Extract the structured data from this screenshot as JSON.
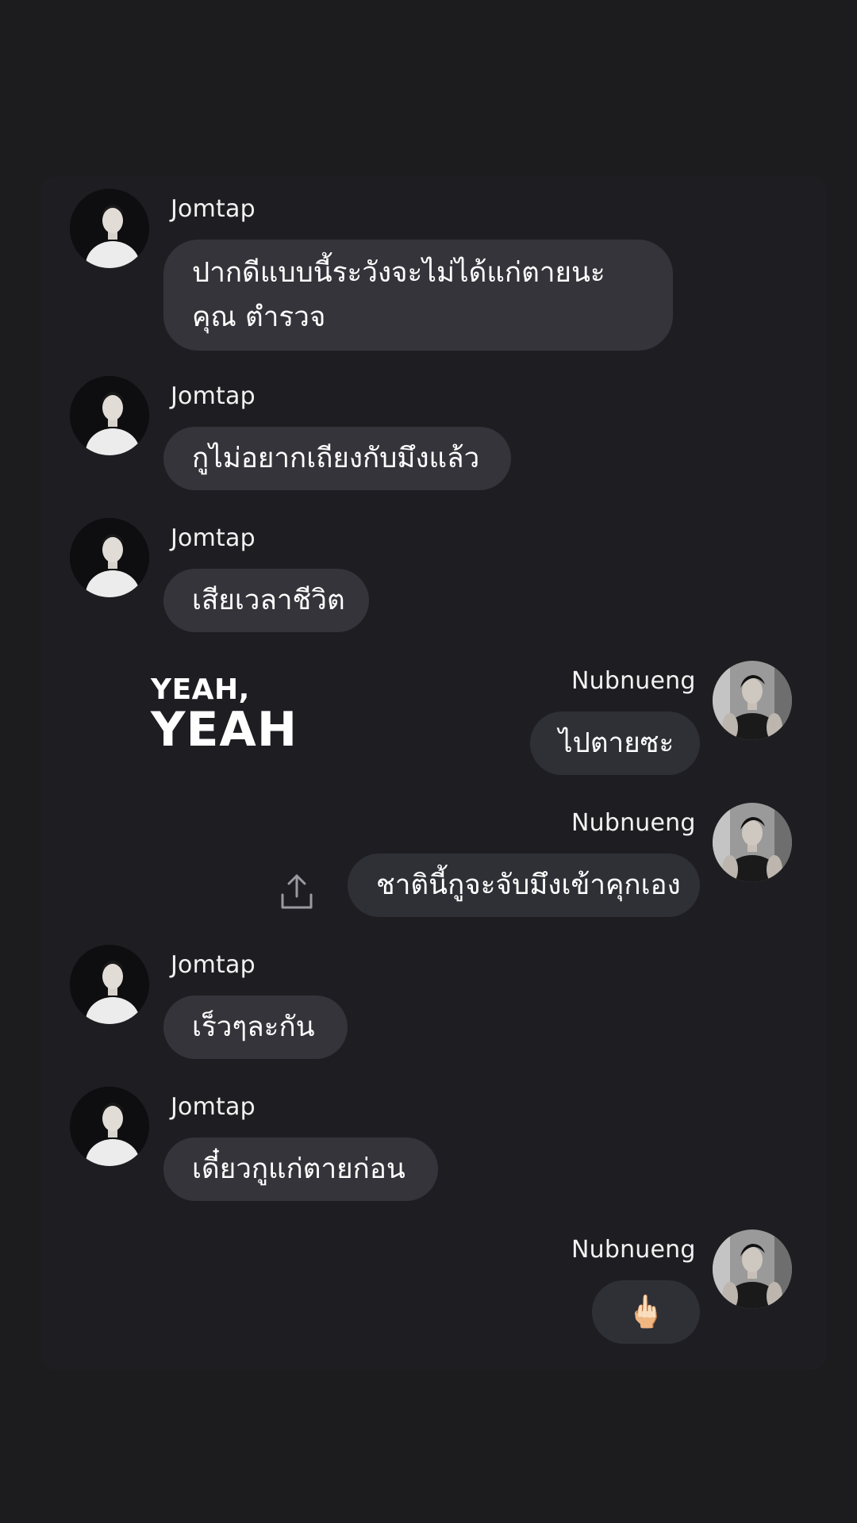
{
  "messages": [
    {
      "sender": "Jomtap",
      "text": "ปากดีแบบนี้ระวังจะไม่ได้แก่ตายนะคุณ ตำรวจ"
    },
    {
      "sender": "Jomtap",
      "text": "กูไม่อยากเถียงกับมึงแล้ว"
    },
    {
      "sender": "Jomtap",
      "text": "เสียเวลาชีวิต"
    },
    {
      "sender": "Nubnueng",
      "text": "ไปตายซะ"
    },
    {
      "sender": "Nubnueng",
      "text": "ชาตินี้กูจะจับมึงเข้าคุกเอง"
    },
    {
      "sender": "Jomtap",
      "text": "เร็วๆละกัน"
    },
    {
      "sender": "Jomtap",
      "text": "เดี๋ยวกูแก่ตายก่อน"
    },
    {
      "sender": "Nubnueng",
      "text": "🖕🏻"
    }
  ],
  "sticker": {
    "line1": "YEAH,",
    "line2": "YEAH"
  },
  "icons": {
    "share": "share-upload-icon",
    "avatar_left": "avatar-jomtap",
    "avatar_right": "avatar-nubnueng"
  },
  "colors": {
    "background": "#1c1c1f",
    "bubble": "#34343a",
    "text": "#ffffff"
  }
}
